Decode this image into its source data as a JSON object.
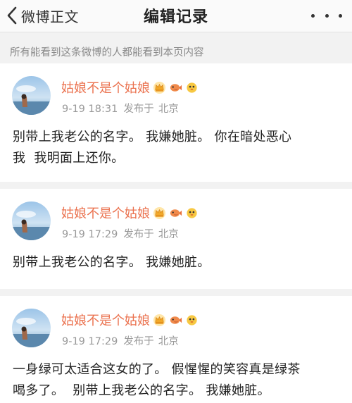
{
  "nav": {
    "back_label": "微博正文",
    "title": "编辑记录"
  },
  "notice": "所有能看到这条微博的人都能看到本页内容",
  "records": [
    {
      "username": "姑娘不是个姑娘",
      "time": "9-19 18:31",
      "source": "发布于",
      "location": "北京",
      "text": [
        "别带上我老公的名字。 我嫌她脏。 你在暗处恶心",
        "我  我明面上还你。"
      ]
    },
    {
      "username": "姑娘不是个姑娘",
      "time": "9-19 17:29",
      "source": "发布于",
      "location": "北京",
      "text": [
        "别带上我老公的名字。 我嫌她脏。"
      ]
    },
    {
      "username": "姑娘不是个姑娘",
      "time": "9-19 17:29",
      "source": "发布于",
      "location": "北京",
      "text": [
        "一身绿可太适合这女的了。 假惺惺的笑容真是绿茶",
        "喝多了。  别带上我老公的名字。 我嫌她脏。"
      ]
    }
  ],
  "colors": {
    "username": "#eb7350",
    "meta": "#999999",
    "background": "#f2f2f2"
  },
  "icons": [
    "back-chevron-icon",
    "more-dots-icon",
    "crown-badge-icon",
    "fish-badge-icon",
    "puffer-badge-icon"
  ]
}
